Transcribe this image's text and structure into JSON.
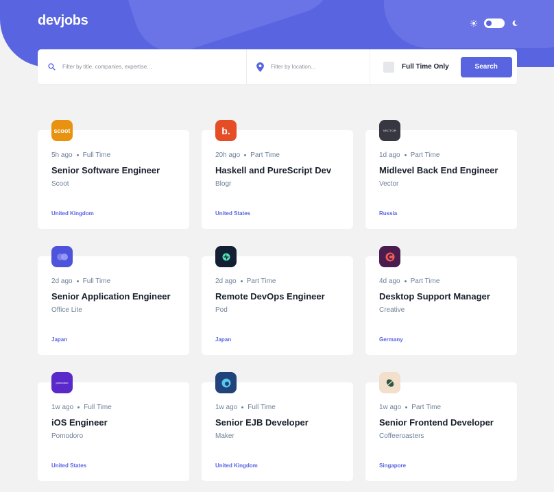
{
  "app": {
    "logo": "devjobs"
  },
  "theme": {
    "mode": "light"
  },
  "search": {
    "title_placeholder": "Filter by title, companies, expertise…",
    "location_placeholder": "Filter by location…",
    "fulltime_label": "Full Time Only",
    "fulltime_checked": false,
    "button_label": "Search"
  },
  "jobs": [
    {
      "posted": "5h ago",
      "contract": "Full Time",
      "title": "Senior Software Engineer",
      "company": "Scoot",
      "location": "United Kingdom",
      "logo_text": "scoot",
      "logo_color": "#e99210"
    },
    {
      "posted": "20h ago",
      "contract": "Part Time",
      "title": "Haskell and PureScript Dev",
      "company": "Blogr",
      "location": "United States",
      "logo_text": "b.",
      "logo_color": "#e54d26"
    },
    {
      "posted": "1d ago",
      "contract": "Part Time",
      "title": "Midlevel Back End Engineer",
      "company": "Vector",
      "location": "Russia",
      "logo_text": "VECTOR",
      "logo_color": "#373741"
    },
    {
      "posted": "2d ago",
      "contract": "Full Time",
      "title": "Senior Application Engineer",
      "company": "Office Lite",
      "location": "Japan",
      "logo_text": "",
      "logo_color": "#4d53db"
    },
    {
      "posted": "2d ago",
      "contract": "Part Time",
      "title": "Remote DevOps Engineer",
      "company": "Pod",
      "location": "Japan",
      "logo_text": "",
      "logo_color": "#132034"
    },
    {
      "posted": "4d ago",
      "contract": "Part Time",
      "title": "Desktop Support Manager",
      "company": "Creative",
      "location": "Germany",
      "logo_text": "",
      "logo_color": "#4b1d4e"
    },
    {
      "posted": "1w ago",
      "contract": "Full Time",
      "title": "iOS Engineer",
      "company": "Pomodoro",
      "location": "United States",
      "logo_text": "pomodoro",
      "logo_color": "#5a29c9"
    },
    {
      "posted": "1w ago",
      "contract": "Full Time",
      "title": "Senior EJB Developer",
      "company": "Maker",
      "location": "United Kingdom",
      "logo_text": "",
      "logo_color": "#21437a"
    },
    {
      "posted": "1w ago",
      "contract": "Part Time",
      "title": "Senior Frontend Developer",
      "company": "Coffeeroasters",
      "location": "Singapore",
      "logo_text": "",
      "logo_color": "#f2dfcc"
    }
  ],
  "colors": {
    "accent": "#5964e0",
    "background": "#f2f2f2",
    "text": "#19202d",
    "muted": "#6e8098"
  }
}
